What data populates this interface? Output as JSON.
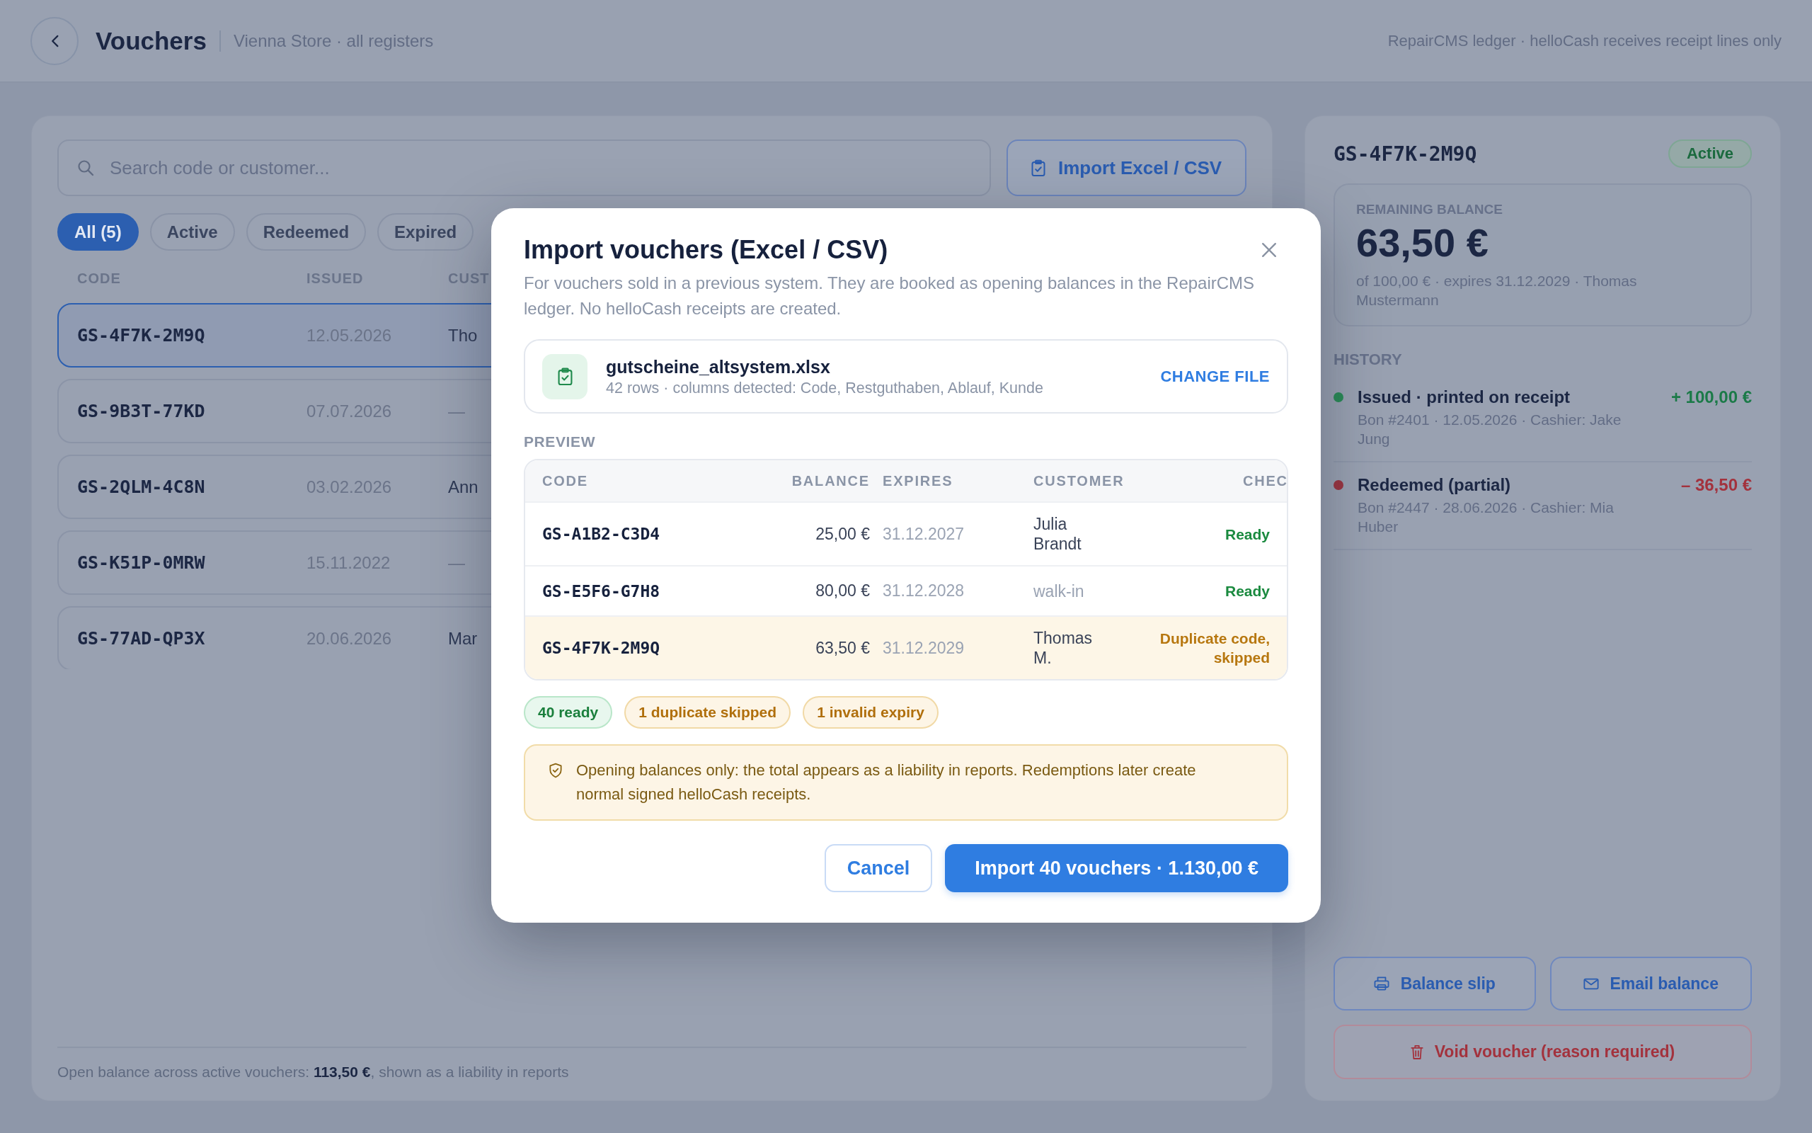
{
  "header": {
    "title": "Vouchers",
    "subtitle": "Vienna Store · all registers",
    "note": "RepairCMS ledger · helloCash receives receipt lines only"
  },
  "voucher_list": {
    "search": {
      "placeholder": "Search code or customer..."
    },
    "import_button": "Import Excel / CSV",
    "filters": [
      {
        "label": "All (5)",
        "selected": true
      },
      {
        "label": "Active",
        "selected": false
      },
      {
        "label": "Redeemed",
        "selected": false
      },
      {
        "label": "Expired",
        "selected": false
      }
    ],
    "columns": [
      "CODE",
      "ISSUED",
      "CUST"
    ],
    "rows": [
      {
        "code": "GS-4F7K-2M9Q",
        "issued": "12.05.2026",
        "customer": "Tho",
        "customer_muted": false,
        "selected": true
      },
      {
        "code": "GS-9B3T-77KD",
        "issued": "07.07.2026",
        "customer": "—",
        "customer_muted": true,
        "selected": false
      },
      {
        "code": "GS-2QLM-4C8N",
        "issued": "03.02.2026",
        "customer": "Ann",
        "customer_muted": false,
        "selected": false
      },
      {
        "code": "GS-K51P-0MRW",
        "issued": "15.11.2022",
        "customer": "—",
        "customer_muted": true,
        "selected": false
      },
      {
        "code": "GS-77AD-QP3X",
        "issued": "20.06.2026",
        "customer": "Mar",
        "customer_muted": false,
        "selected": false
      }
    ],
    "footer": "Open balance across active vouchers: **113,50 €**, shown as a liability in reports"
  },
  "voucher_detail": {
    "code": "GS-4F7K-2M9Q",
    "status": {
      "label": "Active",
      "kind": "active"
    },
    "balance_label": "REMAINING BALANCE",
    "balance": "63,50 €",
    "balance_note": "of 100,00 € · expires 31.12.2029 · Thomas Mustermann",
    "history_label": "HISTORY",
    "history": [
      {
        "title": "Issued · printed on receipt",
        "detail": "Bon #2401 · 12.05.2026 · Cashier: Jake Jung",
        "amount": "+ 100,00 €",
        "kind": "credit",
        "color": "#2a8a55"
      },
      {
        "title": "Redeemed (partial)",
        "detail": "Bon #2447 · 28.06.2026 · Cashier: Mia Huber",
        "amount": "– 36,50 €",
        "kind": "debit",
        "color": "#9b3540"
      }
    ],
    "actions": [
      {
        "label": "Balance slip",
        "kind": "print"
      },
      {
        "label": "Email balance",
        "kind": "email"
      },
      {
        "label": "Void voucher (reason required)",
        "kind": "void"
      }
    ]
  },
  "import_dialog": {
    "title": "Import vouchers (Excel / CSV)",
    "description": "For vouchers sold in a previous system. They are booked as opening balances in the RepairCMS ledger. No helloCash receipts are created.",
    "file": {
      "name": "gutscheine_altsystem.xlsx",
      "details": "42 rows · columns detected: Code, Restguthaben, Ablauf, Kunde",
      "action": "CHANGE FILE"
    },
    "preview_label": "PREVIEW",
    "preview": {
      "columns": [
        "CODE",
        "BALANCE",
        "EXPIRES",
        "CUSTOMER",
        "CHEC"
      ],
      "rows": [
        {
          "code": "GS-A1B2-C3D4",
          "balance": "25,00 €",
          "expires": "31.12.2027",
          "customer": "Julia Brandt",
          "customer_muted": false,
          "check": "Ready",
          "kind": "ready"
        },
        {
          "code": "GS-E5F6-G7H8",
          "balance": "80,00 €",
          "expires": "31.12.2028",
          "customer": "walk-in",
          "customer_muted": true,
          "check": "Ready",
          "kind": "ready"
        },
        {
          "code": "GS-4F7K-2M9Q",
          "balance": "63,50 €",
          "expires": "31.12.2029",
          "customer": "Thomas M.",
          "customer_muted": false,
          "check": "Duplicate code, skipped",
          "kind": "duplicate"
        }
      ]
    },
    "summary": [
      {
        "label": "40 ready",
        "kind": "ok"
      },
      {
        "label": "1 duplicate skipped",
        "kind": "warn"
      },
      {
        "label": "1 invalid expiry",
        "kind": "warn"
      }
    ],
    "notice": "Opening balances only: the total appears as a liability in reports. Redemptions later create normal signed helloCash receipts.",
    "buttons": [
      {
        "label": "Cancel",
        "kind": "cancel"
      },
      {
        "label": "Import 40 vouchers · 1.130,00 €",
        "kind": "confirm"
      }
    ]
  }
}
